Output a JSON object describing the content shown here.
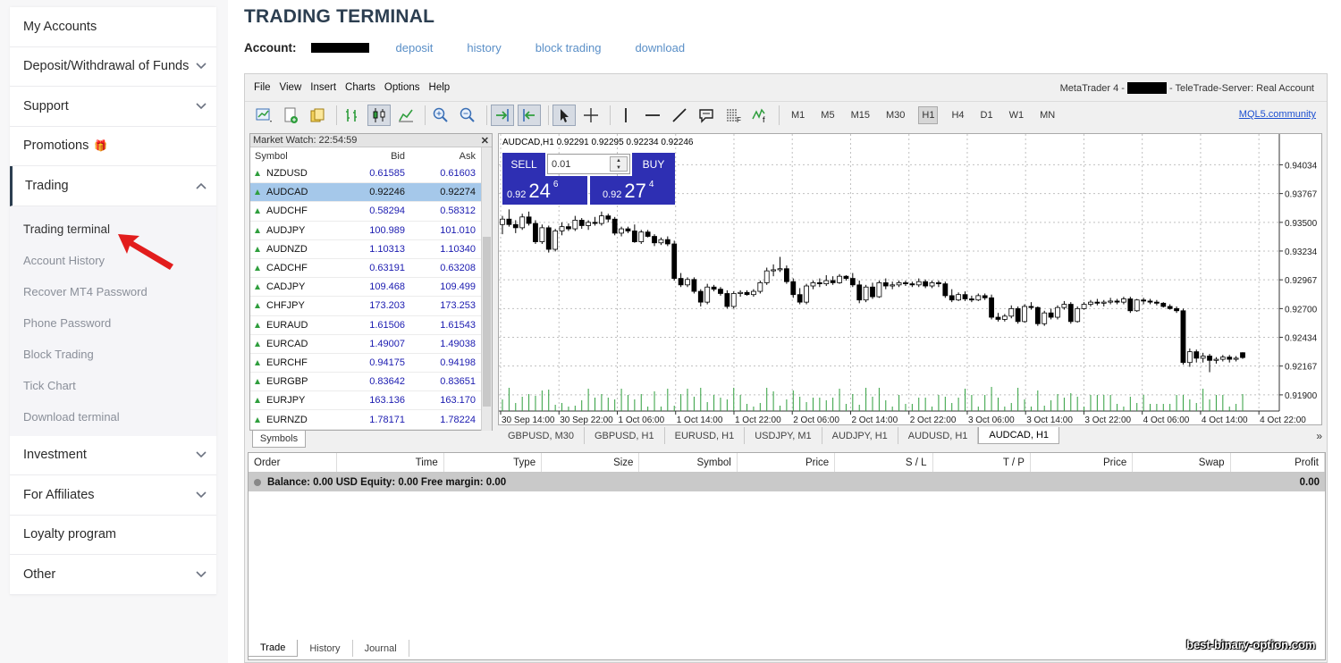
{
  "sidebar": {
    "items": [
      {
        "label": "My Accounts",
        "chevron": "none"
      },
      {
        "label": "Deposit/Withdrawal of Funds",
        "chevron": "down"
      },
      {
        "label": "Support",
        "chevron": "down"
      },
      {
        "label": "Promotions",
        "chevron": "none",
        "badge_icon": "gift-icon"
      },
      {
        "label": "Trading",
        "chevron": "up",
        "active": true
      }
    ],
    "trading_submenu": [
      {
        "label": "Trading terminal",
        "current": true
      },
      {
        "label": "Account History"
      },
      {
        "label": "Recover MT4 Password"
      },
      {
        "label": "Phone Password"
      },
      {
        "label": "Block Trading"
      },
      {
        "label": "Tick Chart"
      },
      {
        "label": "Download terminal"
      }
    ],
    "items_after": [
      {
        "label": "Investment",
        "chevron": "down"
      },
      {
        "label": "For Affiliates",
        "chevron": "down"
      },
      {
        "label": "Loyalty program",
        "chevron": "none"
      },
      {
        "label": "Other",
        "chevron": "down"
      }
    ]
  },
  "header": {
    "title": "TRADING TERMINAL",
    "account_label": "Account:",
    "links": [
      "deposit",
      "history",
      "block trading",
      "download"
    ]
  },
  "terminal": {
    "menu": [
      "File",
      "View",
      "Insert",
      "Charts",
      "Options",
      "Help"
    ],
    "mt_prefix": "MetaTrader 4 -",
    "mt_suffix": "- TeleTrade-Server: Real Account",
    "timeframes": [
      "M1",
      "M5",
      "M15",
      "M30",
      "H1",
      "H4",
      "D1",
      "W1",
      "MN"
    ],
    "active_timeframe": "H1",
    "mql5_link": "MQL5.community",
    "market_watch": {
      "title": "Market Watch: 22:54:59",
      "columns": [
        "Symbol",
        "Bid",
        "Ask"
      ],
      "rows": [
        {
          "symbol": "NZDUSD",
          "bid": "0.61585",
          "ask": "0.61603"
        },
        {
          "symbol": "AUDCAD",
          "bid": "0.92246",
          "ask": "0.92274",
          "selected": true
        },
        {
          "symbol": "AUDCHF",
          "bid": "0.58294",
          "ask": "0.58312"
        },
        {
          "symbol": "AUDJPY",
          "bid": "100.989",
          "ask": "101.010"
        },
        {
          "symbol": "AUDNZD",
          "bid": "1.10313",
          "ask": "1.10340"
        },
        {
          "symbol": "CADCHF",
          "bid": "0.63191",
          "ask": "0.63208"
        },
        {
          "symbol": "CADJPY",
          "bid": "109.468",
          "ask": "109.499"
        },
        {
          "symbol": "CHFJPY",
          "bid": "173.203",
          "ask": "173.253"
        },
        {
          "symbol": "EURAUD",
          "bid": "1.61506",
          "ask": "1.61543"
        },
        {
          "symbol": "EURCAD",
          "bid": "1.49007",
          "ask": "1.49038"
        },
        {
          "symbol": "EURCHF",
          "bid": "0.94175",
          "ask": "0.94198"
        },
        {
          "symbol": "EURGBP",
          "bid": "0.83642",
          "ask": "0.83651"
        },
        {
          "symbol": "EURJPY",
          "bid": "163.136",
          "ask": "163.170"
        },
        {
          "symbol": "EURNZD",
          "bid": "1.78171",
          "ask": "1.78224"
        }
      ],
      "tab": "Symbols"
    },
    "one_click": {
      "sell_label": "SELL",
      "buy_label": "BUY",
      "lot": "0.01",
      "sell_small": "0.92",
      "sell_big": "24",
      "sell_pip": "6",
      "buy_small": "0.92",
      "buy_big": "27",
      "buy_pip": "4"
    },
    "chart_tabs": [
      "GBPUSD, M30",
      "GBPUSD, H1",
      "EURUSD, H1",
      "USDJPY, M1",
      "AUDJPY, H1",
      "AUDUSD, H1",
      "AUDCAD, H1"
    ],
    "active_chart_tab": "AUDCAD, H1",
    "chart_tabs_more": "»",
    "trade_panel": {
      "columns": [
        "Order",
        "Time",
        "Type",
        "Size",
        "Symbol",
        "Price",
        "S / L",
        "T / P",
        "Price",
        "Swap",
        "Profit"
      ],
      "balance_text": "Balance: 0.00 USD  Equity: 0.00  Free margin: 0.00",
      "profit_total": "0.00",
      "tabs": [
        "Trade",
        "History",
        "Journal"
      ],
      "active_tab": "Trade"
    }
  },
  "chart_data": {
    "type": "candlestick",
    "title": "AUDCAD,H1  0.92291 0.92295 0.92234 0.92246",
    "ylim": [
      0.9175,
      0.9417
    ],
    "yticks": [
      "0.94034",
      "0.93767",
      "0.93500",
      "0.93234",
      "0.92967",
      "0.92700",
      "0.92434",
      "0.92167",
      "0.91900"
    ],
    "xticks": [
      "30 Sep 14:00",
      "30 Sep 22:00",
      "1 Oct 06:00",
      "1 Oct 14:00",
      "1 Oct 22:00",
      "2 Oct 06:00",
      "2 Oct 14:00",
      "2 Oct 22:00",
      "3 Oct 06:00",
      "3 Oct 14:00",
      "3 Oct 22:00",
      "4 Oct 06:00",
      "4 Oct 14:00",
      "4 Oct 22:00"
    ],
    "candles": [
      [
        0.9348,
        0.9356,
        0.9339,
        0.9353
      ],
      [
        0.9353,
        0.9362,
        0.9346,
        0.9348
      ],
      [
        0.9348,
        0.9352,
        0.934,
        0.9345
      ],
      [
        0.9345,
        0.9358,
        0.9343,
        0.9355
      ],
      [
        0.9355,
        0.936,
        0.9347,
        0.9349
      ],
      [
        0.9349,
        0.9352,
        0.933,
        0.9332
      ],
      [
        0.9332,
        0.9348,
        0.933,
        0.9345
      ],
      [
        0.9345,
        0.9347,
        0.9322,
        0.9325
      ],
      [
        0.9325,
        0.9344,
        0.9323,
        0.9342
      ],
      [
        0.9342,
        0.935,
        0.9338,
        0.9346
      ],
      [
        0.9346,
        0.9349,
        0.9342,
        0.9344
      ],
      [
        0.9344,
        0.9356,
        0.9342,
        0.9352
      ],
      [
        0.9352,
        0.9354,
        0.9344,
        0.9347
      ],
      [
        0.9347,
        0.9352,
        0.9343,
        0.935
      ],
      [
        0.935,
        0.9355,
        0.9347,
        0.9349
      ],
      [
        0.9349,
        0.936,
        0.9347,
        0.9356
      ],
      [
        0.9356,
        0.9358,
        0.935,
        0.9353
      ],
      [
        0.9353,
        0.9355,
        0.9338,
        0.934
      ],
      [
        0.934,
        0.9346,
        0.9337,
        0.9344
      ],
      [
        0.9344,
        0.9346,
        0.934,
        0.9342
      ],
      [
        0.9342,
        0.9348,
        0.9331,
        0.9332
      ],
      [
        0.9332,
        0.9343,
        0.933,
        0.9341
      ],
      [
        0.9341,
        0.9343,
        0.9336,
        0.9337
      ],
      [
        0.9337,
        0.9339,
        0.9328,
        0.9331
      ],
      [
        0.9331,
        0.9336,
        0.9329,
        0.9334
      ],
      [
        0.9334,
        0.9337,
        0.9328,
        0.933
      ],
      [
        0.933,
        0.9333,
        0.9296,
        0.9298
      ],
      [
        0.9298,
        0.9303,
        0.929,
        0.9292
      ],
      [
        0.9292,
        0.9299,
        0.929,
        0.9297
      ],
      [
        0.9297,
        0.9299,
        0.9284,
        0.9286
      ],
      [
        0.9286,
        0.9288,
        0.9272,
        0.9276
      ],
      [
        0.9276,
        0.9293,
        0.9274,
        0.929
      ],
      [
        0.929,
        0.9292,
        0.9286,
        0.9288
      ],
      [
        0.9288,
        0.929,
        0.9282,
        0.9284
      ],
      [
        0.9284,
        0.9287,
        0.927,
        0.9272
      ],
      [
        0.9272,
        0.9286,
        0.927,
        0.9284
      ],
      [
        0.9284,
        0.9287,
        0.9281,
        0.9285
      ],
      [
        0.9285,
        0.9287,
        0.9282,
        0.9283
      ],
      [
        0.9283,
        0.9288,
        0.9281,
        0.9286
      ],
      [
        0.9286,
        0.9296,
        0.9284,
        0.9294
      ],
      [
        0.9294,
        0.9308,
        0.9292,
        0.9305
      ],
      [
        0.9305,
        0.9311,
        0.93,
        0.9306
      ],
      [
        0.9306,
        0.9318,
        0.9304,
        0.9307
      ],
      [
        0.9307,
        0.931,
        0.9293,
        0.9295
      ],
      [
        0.9295,
        0.9298,
        0.928,
        0.9283
      ],
      [
        0.9283,
        0.9289,
        0.9274,
        0.9276
      ],
      [
        0.9276,
        0.9293,
        0.9274,
        0.9291
      ],
      [
        0.9291,
        0.9296,
        0.9288,
        0.9294
      ],
      [
        0.9294,
        0.9298,
        0.929,
        0.9293
      ],
      [
        0.9293,
        0.9301,
        0.9291,
        0.9296
      ],
      [
        0.9296,
        0.93,
        0.9292,
        0.9294
      ],
      [
        0.9294,
        0.9302,
        0.9293,
        0.93
      ],
      [
        0.93,
        0.9301,
        0.9296,
        0.9298
      ],
      [
        0.9298,
        0.9303,
        0.929,
        0.9292
      ],
      [
        0.9292,
        0.9296,
        0.9275,
        0.9278
      ],
      [
        0.9278,
        0.9292,
        0.9276,
        0.929
      ],
      [
        0.929,
        0.9294,
        0.9279,
        0.9281
      ],
      [
        0.9281,
        0.9296,
        0.928,
        0.9294
      ],
      [
        0.9294,
        0.9298,
        0.9288,
        0.9291
      ],
      [
        0.9291,
        0.9295,
        0.9288,
        0.9292
      ],
      [
        0.9292,
        0.9296,
        0.929,
        0.9294
      ],
      [
        0.9294,
        0.9296,
        0.9291,
        0.9293
      ],
      [
        0.9293,
        0.9295,
        0.929,
        0.9292
      ],
      [
        0.9292,
        0.9298,
        0.929,
        0.9295
      ],
      [
        0.9295,
        0.9297,
        0.9289,
        0.9291
      ],
      [
        0.9291,
        0.9296,
        0.9289,
        0.9294
      ],
      [
        0.9294,
        0.9296,
        0.929,
        0.9293
      ],
      [
        0.9293,
        0.9295,
        0.928,
        0.9282
      ],
      [
        0.9282,
        0.9288,
        0.9276,
        0.9278
      ],
      [
        0.9278,
        0.9285,
        0.9277,
        0.9283
      ],
      [
        0.9283,
        0.9286,
        0.9277,
        0.9279
      ],
      [
        0.9279,
        0.9282,
        0.9276,
        0.9278
      ],
      [
        0.9278,
        0.9284,
        0.9277,
        0.9282
      ],
      [
        0.9282,
        0.9284,
        0.9278,
        0.928
      ],
      [
        0.928,
        0.9283,
        0.926,
        0.9262
      ],
      [
        0.9262,
        0.9266,
        0.9258,
        0.926
      ],
      [
        0.926,
        0.9265,
        0.9258,
        0.9263
      ],
      [
        0.9263,
        0.9273,
        0.9261,
        0.927
      ],
      [
        0.927,
        0.9272,
        0.9256,
        0.9258
      ],
      [
        0.9258,
        0.9274,
        0.9257,
        0.9272
      ],
      [
        0.9272,
        0.9276,
        0.9269,
        0.9271
      ],
      [
        0.9271,
        0.9272,
        0.9254,
        0.9256
      ],
      [
        0.9256,
        0.9268,
        0.9254,
        0.9266
      ],
      [
        0.9266,
        0.927,
        0.926,
        0.9262
      ],
      [
        0.9262,
        0.9273,
        0.926,
        0.9271
      ],
      [
        0.9271,
        0.9277,
        0.9269,
        0.9274
      ],
      [
        0.9274,
        0.9276,
        0.9256,
        0.9258
      ],
      [
        0.9258,
        0.9272,
        0.9257,
        0.927
      ],
      [
        0.927,
        0.9276,
        0.9269,
        0.9274
      ],
      [
        0.9274,
        0.9278,
        0.9272,
        0.9276
      ],
      [
        0.9276,
        0.9279,
        0.9273,
        0.9275
      ],
      [
        0.9275,
        0.9278,
        0.9272,
        0.9276
      ],
      [
        0.9276,
        0.928,
        0.9274,
        0.9277
      ],
      [
        0.9277,
        0.9279,
        0.9274,
        0.9276
      ],
      [
        0.9276,
        0.9281,
        0.9274,
        0.9279
      ],
      [
        0.9279,
        0.9281,
        0.9266,
        0.9268
      ],
      [
        0.9268,
        0.9279,
        0.9267,
        0.9278
      ],
      [
        0.9278,
        0.928,
        0.9274,
        0.9277
      ],
      [
        0.9277,
        0.9279,
        0.9274,
        0.9276
      ],
      [
        0.9276,
        0.9278,
        0.9273,
        0.9275
      ],
      [
        0.9275,
        0.9276,
        0.9271,
        0.9272
      ],
      [
        0.9272,
        0.9274,
        0.9269,
        0.927
      ],
      [
        0.927,
        0.9272,
        0.9266,
        0.9268
      ],
      [
        0.9268,
        0.927,
        0.9218,
        0.922
      ],
      [
        0.922,
        0.9233,
        0.9216,
        0.923
      ],
      [
        0.923,
        0.9232,
        0.922,
        0.9224
      ],
      [
        0.9224,
        0.9229,
        0.922,
        0.9226
      ],
      [
        0.9226,
        0.9228,
        0.9211,
        0.9222
      ],
      [
        0.9222,
        0.9225,
        0.9219,
        0.9223
      ],
      [
        0.9223,
        0.9227,
        0.9221,
        0.9225
      ],
      [
        0.9225,
        0.9227,
        0.922,
        0.9223
      ],
      [
        0.9223,
        0.9226,
        0.9221,
        0.9224
      ],
      [
        0.92291,
        0.92295,
        0.92234,
        0.92246
      ]
    ],
    "volume_note": "volume histogram shown as bars at chart bottom"
  }
}
